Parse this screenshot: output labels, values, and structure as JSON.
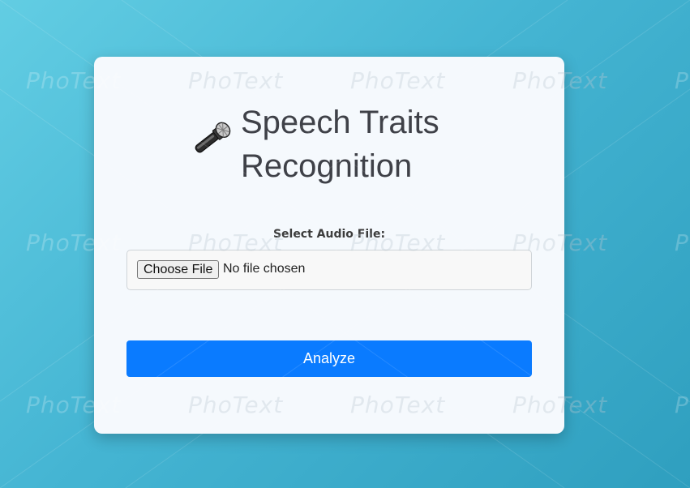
{
  "app": {
    "title": "Speech Traits Recognition",
    "icon": "microphone-icon"
  },
  "upload": {
    "label": "Select Audio File:",
    "choose_button_label": "Choose File",
    "status_text": "No file chosen"
  },
  "actions": {
    "analyze_label": "Analyze"
  },
  "watermark": {
    "text": "PhoText"
  },
  "colors": {
    "background_start": "#62cde3",
    "background_end": "#2f9fbf",
    "card": "#f5f9fd",
    "primary": "#0a7bff",
    "title_text": "#3f4148"
  }
}
